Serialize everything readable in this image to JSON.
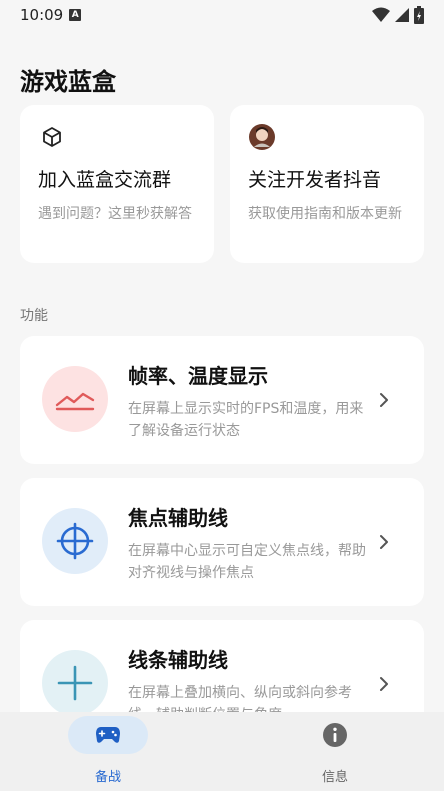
{
  "status_bar": {
    "time": "10:09",
    "badge": "A"
  },
  "page_title": "游戏蓝盒",
  "top_cards": [
    {
      "icon": "cube-icon",
      "title": "加入蓝盒交流群",
      "desc": "遇到问题？这里秒获解答"
    },
    {
      "icon": "avatar",
      "title": "关注开发者抖音",
      "desc": "获取使用指南和版本更新"
    }
  ],
  "section_label": "功能",
  "features": [
    {
      "icon": "chart-line-icon",
      "title": "帧率、温度显示",
      "desc": "在屏幕上显示实时的FPS和温度，用来了解设备运行状态"
    },
    {
      "icon": "crosshair-icon",
      "title": "焦点辅助线",
      "desc": "在屏幕中心显示可自定义焦点线，帮助对齐视线与操作焦点"
    },
    {
      "icon": "plus-icon",
      "title": "线条辅助线",
      "desc": "在屏幕上叠加横向、纵向或斜向参考线，辅助判断位置与角度"
    }
  ],
  "nav": {
    "home_label": "备战",
    "info_label": "信息"
  },
  "colors": {
    "accent": "#2a6bd1",
    "red_soft": "#fde2e2",
    "blue_soft": "#e1edf9"
  }
}
